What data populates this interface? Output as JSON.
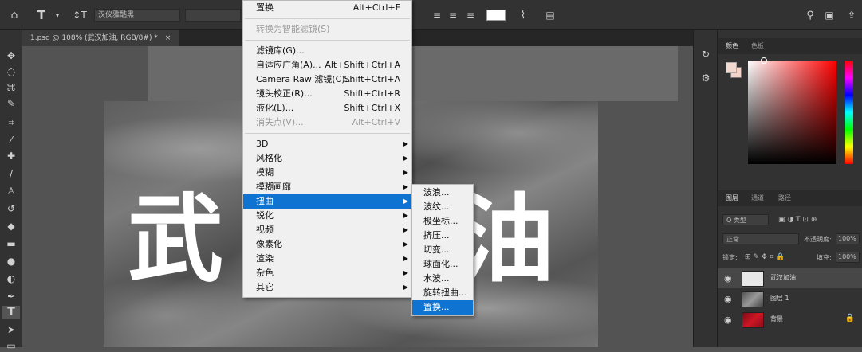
{
  "options_bar": {
    "font_family": "汉仪雅酷黑",
    "icons": [
      "home-icon",
      "type-tool-icon",
      "text-orientation-icon",
      "align-left-icon",
      "align-center-icon",
      "align-right-icon",
      "warp-text-icon",
      "character-panel-icon",
      "search-icon",
      "workspace-icon",
      "share-icon"
    ]
  },
  "document_tab": {
    "label": "1.psd @ 108% (武汉加油, RGB/8#) *",
    "close": "×"
  },
  "canvas": {
    "chars": [
      "武",
      "油"
    ]
  },
  "filter_menu": {
    "items": [
      {
        "label": "置换",
        "shortcut": "Alt+Ctrl+F",
        "disabled": false
      },
      {
        "separator": true
      },
      {
        "label": "转换为智能滤镜(S)",
        "shortcut": "",
        "disabled": true
      },
      {
        "separator": true
      },
      {
        "label": "滤镜库(G)...",
        "shortcut": "",
        "disabled": false
      },
      {
        "label": "自适应广角(A)...",
        "shortcut": "Alt+Shift+Ctrl+A",
        "disabled": false
      },
      {
        "label": "Camera Raw 滤镜(C)...",
        "shortcut": "Shift+Ctrl+A",
        "disabled": false
      },
      {
        "label": "镜头校正(R)...",
        "shortcut": "Shift+Ctrl+R",
        "disabled": false
      },
      {
        "label": "液化(L)...",
        "shortcut": "Shift+Ctrl+X",
        "disabled": false
      },
      {
        "label": "消失点(V)...",
        "shortcut": "Alt+Ctrl+V",
        "disabled": true
      },
      {
        "separator": true
      },
      {
        "label": "3D",
        "submenu": true
      },
      {
        "label": "风格化",
        "submenu": true
      },
      {
        "label": "模糊",
        "submenu": true
      },
      {
        "label": "模糊画廊",
        "submenu": true
      },
      {
        "label": "扭曲",
        "submenu": true,
        "highlighted": true
      },
      {
        "label": "锐化",
        "submenu": true
      },
      {
        "label": "视频",
        "submenu": true
      },
      {
        "label": "像素化",
        "submenu": true
      },
      {
        "label": "渲染",
        "submenu": true
      },
      {
        "label": "杂色",
        "submenu": true
      },
      {
        "label": "其它",
        "submenu": true
      }
    ]
  },
  "distort_submenu": {
    "items": [
      {
        "label": "波浪..."
      },
      {
        "label": "波纹..."
      },
      {
        "label": "极坐标..."
      },
      {
        "label": "挤压..."
      },
      {
        "label": "切变..."
      },
      {
        "label": "球面化..."
      },
      {
        "label": "水波..."
      },
      {
        "label": "旋转扭曲..."
      },
      {
        "label": "置换...",
        "highlighted": true
      }
    ]
  },
  "color_panel": {
    "tabs": [
      "颜色",
      "色板"
    ],
    "fg_color": "#f2d9d0",
    "bg_color": "#f5d3c9"
  },
  "layers_panel": {
    "tabs": [
      "图层",
      "通道",
      "路径"
    ],
    "filter_label": "Q 类型",
    "blend_mode": "正常",
    "opacity_label": "不透明度:",
    "opacity_value": "100%",
    "lock_label": "锁定:",
    "fill_label": "填充:",
    "fill_value": "100%",
    "layers": [
      {
        "name": "武汉加油",
        "selected": true,
        "thumb": "text"
      },
      {
        "name": "图层 1",
        "selected": false,
        "thumb": "cloth"
      },
      {
        "name": "背景",
        "selected": false,
        "thumb": "red",
        "locked": true
      }
    ]
  },
  "colors": {
    "highlight": "#0f74d1",
    "menu_bg": "#f0f0f0",
    "panel_bg": "#323232"
  }
}
